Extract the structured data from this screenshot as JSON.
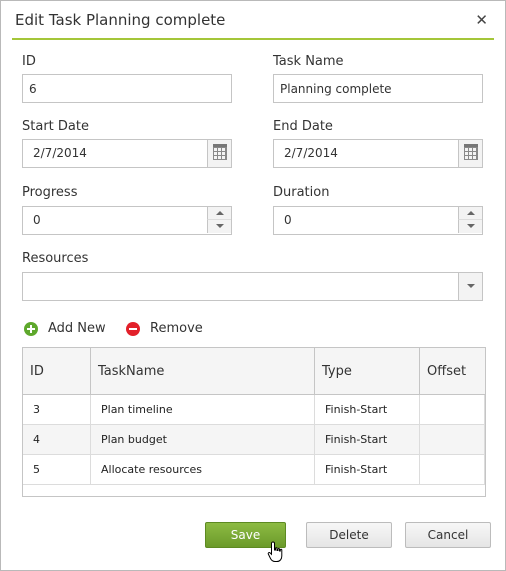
{
  "dialog": {
    "title": "Edit Task Planning complete",
    "close_symbol": "✕"
  },
  "form": {
    "id": {
      "label": "ID",
      "value": "6"
    },
    "task_name": {
      "label": "Task Name",
      "value": "Planning complete"
    },
    "start_date": {
      "label": "Start Date",
      "value": "2/7/2014",
      "icon": "calendar-icon"
    },
    "end_date": {
      "label": "End Date",
      "value": "2/7/2014",
      "icon": "calendar-icon"
    },
    "progress": {
      "label": "Progress",
      "value": "0"
    },
    "duration": {
      "label": "Duration",
      "value": "0"
    },
    "resources": {
      "label": "Resources",
      "value": ""
    }
  },
  "dependencies": {
    "add_label": "Add New",
    "remove_label": "Remove",
    "columns": [
      "ID",
      "TaskName",
      "Type",
      "Offset"
    ],
    "rows": [
      {
        "id": "3",
        "task_name": "Plan timeline",
        "type": "Finish-Start",
        "offset": ""
      },
      {
        "id": "4",
        "task_name": "Plan budget",
        "type": "Finish-Start",
        "offset": ""
      },
      {
        "id": "5",
        "task_name": "Allocate resources",
        "type": "Finish-Start",
        "offset": ""
      }
    ]
  },
  "footer": {
    "save_label": "Save",
    "delete_label": "Delete",
    "cancel_label": "Cancel"
  },
  "colors": {
    "accent": "#a4c639",
    "save_button": "#7aa832",
    "add_icon": "#5ea82c",
    "remove_icon": "#e2202a"
  }
}
